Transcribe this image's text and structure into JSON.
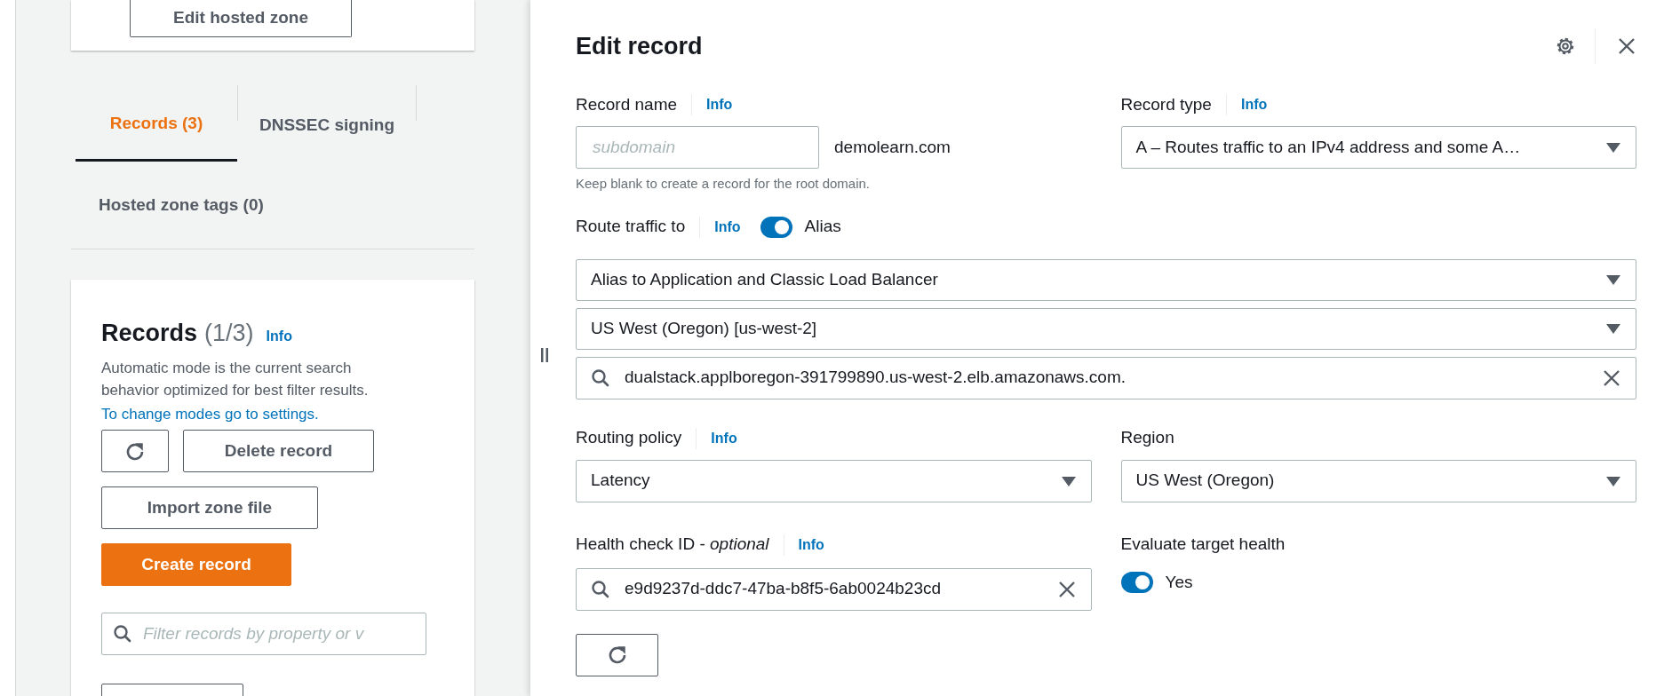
{
  "left_panel": {
    "edit_hosted_zone_button": "Edit hosted zone",
    "tabs": [
      {
        "label": "Records (3)",
        "selected": true
      },
      {
        "label": "DNSSEC signing",
        "selected": false
      },
      {
        "label": "Hosted zone tags (0)",
        "selected": false
      }
    ],
    "records": {
      "title": "Records",
      "count": "(1/3)",
      "info": "Info",
      "description": "Automatic mode is the current search behavior optimized for best filter results.",
      "settings_link": "To change modes go to settings.",
      "buttons": [
        {
          "kind": "refresh"
        },
        {
          "kind": "normal",
          "label": "Delete record"
        },
        {
          "kind": "normal",
          "label": "Import zone file"
        },
        {
          "kind": "primary",
          "label": "Create record"
        }
      ],
      "filter": {
        "placeholder": "Filter records by property or v"
      }
    }
  },
  "edit_record": {
    "title": "Edit record",
    "record_name": {
      "label": "Record name",
      "info": "Info",
      "placeholder": "subdomain",
      "suffix": "demolearn.com",
      "hint": "Keep blank to create a record for the root domain."
    },
    "record_type": {
      "label": "Record type",
      "info": "Info",
      "value": "A – Routes traffic to an IPv4 address and some A…"
    },
    "route_traffic": {
      "label": "Route traffic to",
      "info": "Info",
      "alias_on": true,
      "alias_label": "Alias"
    },
    "alias_fields": [
      {
        "kind": "select",
        "value": "Alias to Application and Classic Load Balancer"
      },
      {
        "kind": "select",
        "value": "US West (Oregon) [us-west-2]"
      },
      {
        "kind": "search",
        "value": "dualstack.applboregon-391799890.us-west-2.elb.amazonaws.com."
      }
    ],
    "routing_policy": {
      "label": "Routing policy",
      "info": "Info",
      "value": "Latency"
    },
    "region": {
      "label": "Region",
      "value": "US West (Oregon)"
    },
    "health_check": {
      "label": "Health check ID - *optional*",
      "info": "Info",
      "value": "e9d9237d-ddc7-47ba-b8f5-6ab0024b23cd"
    },
    "evaluate_target_health": {
      "label": "Evaluate target health",
      "on": true,
      "value_label": "Yes"
    }
  }
}
